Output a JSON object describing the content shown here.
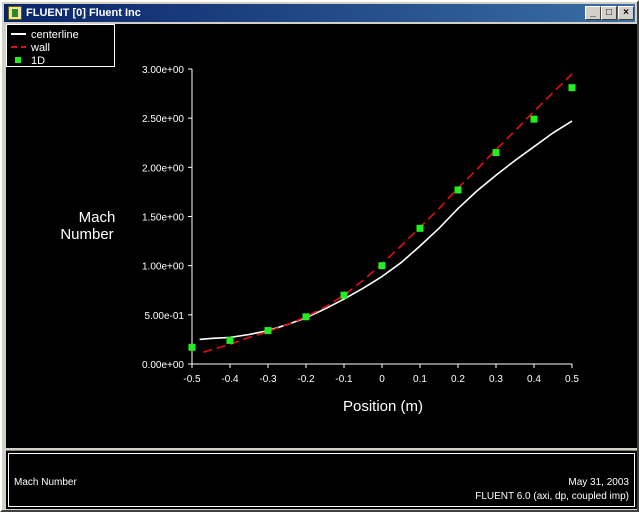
{
  "window": {
    "title": "FLUENT [0] Fluent Inc",
    "buttons": {
      "minimize": "_",
      "maximize": "□",
      "close": "×"
    }
  },
  "status": {
    "left": "Mach Number",
    "date": "May 31, 2003",
    "version": "FLUENT 6.0 (axi, dp, coupled imp)"
  },
  "colors": {
    "centerline": "#ffffff",
    "wall": "#e01010",
    "oneD": "#22ee22",
    "background": "#000000"
  },
  "chart_data": {
    "type": "line",
    "title": "",
    "xlabel": "Position (m)",
    "ylabel": [
      "Mach",
      "Number"
    ],
    "xlim": [
      -0.5,
      0.5
    ],
    "ylim": [
      0,
      3.0
    ],
    "x_ticks": [
      -0.5,
      -0.4,
      -0.3,
      -0.2,
      -0.1,
      0,
      0.1,
      0.2,
      0.3,
      0.4,
      0.5
    ],
    "x_tick_labels": [
      "-0.5",
      "-0.4",
      "-0.3",
      "-0.2",
      "-0.1",
      "0",
      "0.1",
      "0.2",
      "0.3",
      "0.4",
      "0.5"
    ],
    "y_ticks": [
      0,
      0.5,
      1.0,
      1.5,
      2.0,
      2.5,
      3.0
    ],
    "y_tick_labels": [
      "0.00e+00",
      "5.00e-01",
      "1.00e+00",
      "1.50e+00",
      "2.00e+00",
      "2.50e+00",
      "3.00e+00"
    ],
    "legend_position": "top-left",
    "grid": false,
    "series": [
      {
        "name": "centerline",
        "style": "solid",
        "color": "#ffffff",
        "x": [
          -0.48,
          -0.45,
          -0.4,
          -0.35,
          -0.3,
          -0.25,
          -0.2,
          -0.15,
          -0.1,
          -0.05,
          0,
          0.05,
          0.1,
          0.15,
          0.2,
          0.25,
          0.3,
          0.35,
          0.4,
          0.45,
          0.5
        ],
        "y": [
          0.25,
          0.26,
          0.27,
          0.3,
          0.34,
          0.4,
          0.47,
          0.56,
          0.66,
          0.77,
          0.89,
          1.03,
          1.2,
          1.38,
          1.58,
          1.76,
          1.92,
          2.07,
          2.21,
          2.35,
          2.47
        ]
      },
      {
        "name": "wall",
        "style": "dashed",
        "color": "#e01010",
        "x": [
          -0.47,
          -0.4,
          -0.35,
          -0.3,
          -0.25,
          -0.2,
          -0.15,
          -0.1,
          -0.05,
          0,
          0.05,
          0.1,
          0.15,
          0.2,
          0.25,
          0.3,
          0.35,
          0.4,
          0.45,
          0.5
        ],
        "y": [
          0.12,
          0.2,
          0.27,
          0.33,
          0.4,
          0.48,
          0.58,
          0.7,
          0.85,
          1.02,
          1.2,
          1.39,
          1.58,
          1.79,
          1.98,
          2.18,
          2.37,
          2.57,
          2.76,
          2.95
        ]
      },
      {
        "name": "1D",
        "style": "points",
        "color": "#22ee22",
        "x": [
          -0.5,
          -0.4,
          -0.3,
          -0.2,
          -0.1,
          0,
          0.1,
          0.2,
          0.3,
          0.4,
          0.5
        ],
        "y": [
          0.17,
          0.24,
          0.34,
          0.48,
          0.7,
          1.0,
          1.38,
          1.77,
          2.15,
          2.49,
          2.81
        ]
      }
    ]
  }
}
